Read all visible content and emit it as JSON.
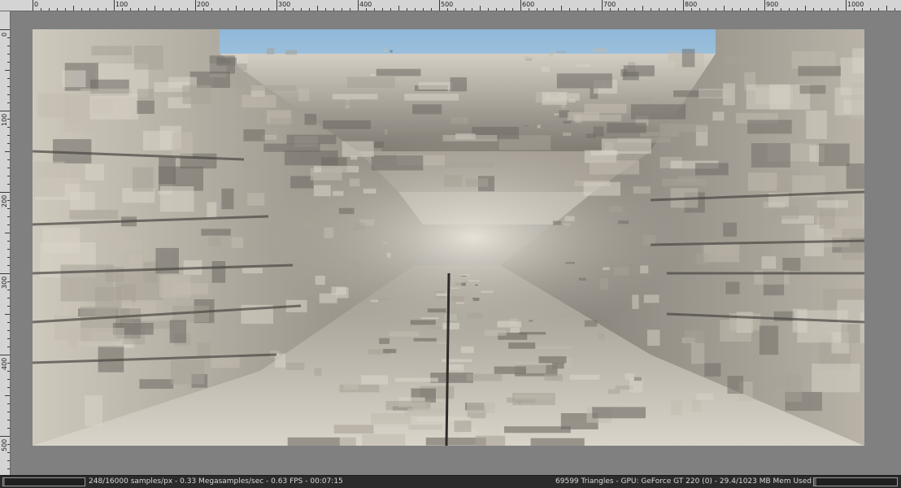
{
  "window": {
    "background": "#808080"
  },
  "ruler_top": {
    "labels": [
      "0",
      "100",
      "200",
      "300",
      "400",
      "500",
      "600",
      "700",
      "800",
      "900",
      "1000"
    ]
  },
  "ruler_left": {
    "labels": [
      "0",
      "100",
      "200",
      "300",
      "400",
      "500"
    ]
  },
  "render": {
    "sky_color": "#9fc4e0",
    "stone_light": "#d8d3c8",
    "stone_mid": "#a8a298",
    "stone_dark": "#6e6a64",
    "shadow": "#4a4743"
  },
  "statusbar": {
    "left_text": "248/16000 samples/px - 0.33 Megasamples/sec - 0.63 FPS - 00:07:15",
    "right_text": "69599 Triangles - GPU: GeForce GT 220 (0) - 29.4/1023 MB Mem Used",
    "samples_progress": 0.0155,
    "memory_progress": 0.0287
  }
}
